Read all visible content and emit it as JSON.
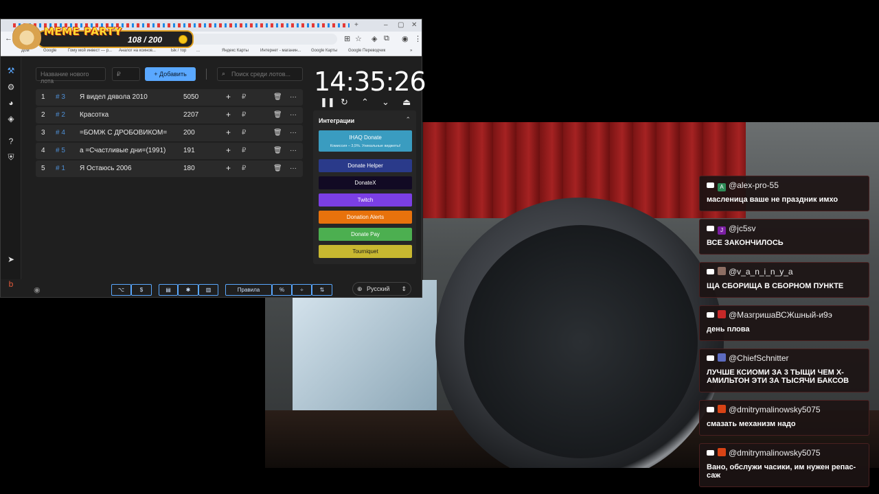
{
  "meme": {
    "title": "MEME PARTY",
    "count": "108 / 200"
  },
  "browser": {
    "bookmarks": [
      "Дом",
      "Google",
      "Гому мой инвест — р...",
      "Аналог на коинов...",
      "Ык / тор",
      "...",
      "Яндекс Карты",
      "Интернет - маганин...",
      "Google Карты",
      "Google Переводчик"
    ]
  },
  "toolbar": {
    "new_lot_placeholder": "Название нового лота",
    "currency_placeholder": "₽",
    "add_label": "Добавить",
    "search_placeholder": "Поиск среди лотов..."
  },
  "lots": [
    {
      "num": "1",
      "id": "# 3",
      "name": "Я видел дявола 2010",
      "amount": "5050"
    },
    {
      "num": "2",
      "id": "# 2",
      "name": "Красотка",
      "amount": "2207"
    },
    {
      "num": "3",
      "id": "# 4",
      "name": "=БОМЖ С ДРОБОВИКОМ=",
      "amount": "200"
    },
    {
      "num": "4",
      "id": "# 5",
      "name": "а =Счастливые дни=(1991)",
      "amount": "191"
    },
    {
      "num": "5",
      "id": "# 1",
      "name": "Я Остаюсь 2006",
      "amount": "180"
    }
  ],
  "row_labels": {
    "plus": "+",
    "rub": "₽",
    "more": "···"
  },
  "timer": {
    "value": "14:35:26"
  },
  "integrations": {
    "title": "Интеграции",
    "buttons": [
      {
        "label": "IHAQ Donate",
        "sub": "Комиссия – 3,5%. Уникальные виджеты!",
        "color": "#3a9cc0"
      },
      {
        "label": "Donate Helper",
        "color": "#2a3a8a"
      },
      {
        "label": "DonateX",
        "color": "#120a24"
      },
      {
        "label": "Twitch",
        "color": "#7b3fe4"
      },
      {
        "label": "Donation Alerts",
        "color": "#e8720c"
      },
      {
        "label": "Donate Pay",
        "color": "#4caf50"
      },
      {
        "label": "Tourniquet",
        "color": "#c8b830"
      }
    ]
  },
  "bottom": {
    "rules_label": "Правила",
    "percent": "%",
    "dollar": "$",
    "language": "Русский"
  },
  "chat": [
    {
      "user": "@alex-pro-55",
      "avatar_letter": "A",
      "avatar_color": "#2e8b57",
      "text": "масленица ваше не праздник имхо"
    },
    {
      "user": "@jc5sv",
      "avatar_letter": "J",
      "avatar_color": "#7b1fa2",
      "text": "ВСЕ ЗАКОНЧИЛОСЬ"
    },
    {
      "user": "@v_a_n_i_n_y_a",
      "avatar_letter": "",
      "avatar_color": "#8d6e63",
      "text": "ЩА СБОРИЩА В СБОРНОМ ПУНКТЕ"
    },
    {
      "user": "@МазгришаВСЖшный-и9э",
      "avatar_letter": "",
      "avatar_color": "#c62828",
      "text": "день плова"
    },
    {
      "user": "@ChiefSchnitter",
      "avatar_letter": "",
      "avatar_color": "#5c6bc0",
      "text": "ЛУЧШЕ КСИОМИ ЗА 3 ТЫЩИ ЧЕМ Х-АМИЛЬТОН ЭТИ ЗА ТЫСЯЧИ БАКСОВ"
    },
    {
      "user": "@dmitrymalinowsky5075",
      "avatar_letter": "",
      "avatar_color": "#d84315",
      "text": "смазать механизм надо"
    },
    {
      "user": "@dmitrymalinowsky5075",
      "avatar_letter": "",
      "avatar_color": "#d84315",
      "text": "Вано, обслужи часики, им нужен репас-саж"
    }
  ]
}
